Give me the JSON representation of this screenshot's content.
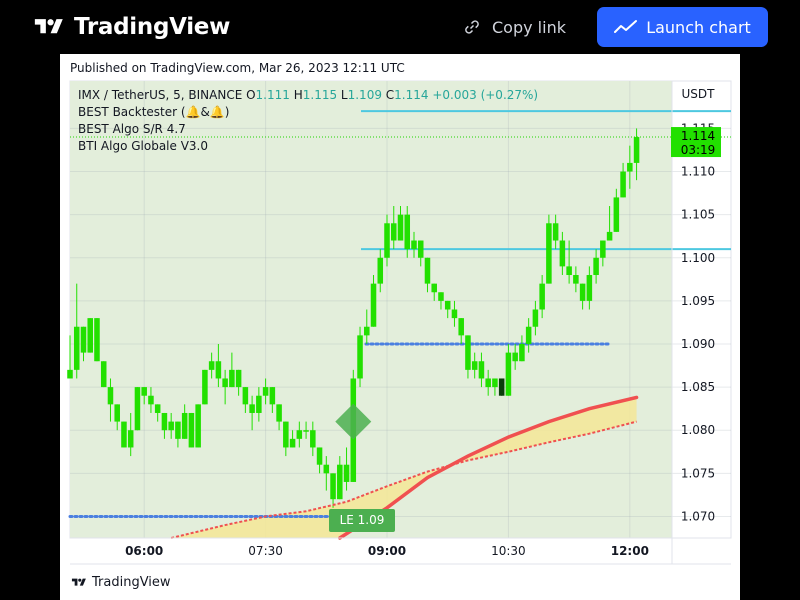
{
  "header": {
    "brand": "TradingView",
    "copy_link_label": "Copy link",
    "launch_chart_label": "Launch chart"
  },
  "published": "Published on TradingView.com, Mar 26, 2023 12:11 UTC",
  "footer_brand": "TradingView",
  "chart_data": {
    "type": "candlestick",
    "symbol_line": {
      "symbol": "IMX / TetherUS, 5, BINANCE",
      "o_label": "O",
      "o_value": "1.111",
      "h_label": "H",
      "h_value": "1.115",
      "l_label": "L",
      "l_value": "1.109",
      "c_label": "C",
      "c_value": "1.114",
      "change": "+0.003 (+0.27%)"
    },
    "indicators": [
      "BEST Backtester (🔔&🔔)",
      "BEST Algo S/R 4.7",
      "BTI Algo Globale V3.0"
    ],
    "y_axis_unit": "USDT",
    "y_ticks": [
      "1.115",
      "1.110",
      "1.105",
      "1.100",
      "1.095",
      "1.090",
      "1.085",
      "1.080",
      "1.075",
      "1.070"
    ],
    "ylim": [
      1.0675,
      1.1205
    ],
    "x_ticks": [
      "06:00",
      "07:30",
      "09:00",
      "10:30",
      "12:00"
    ],
    "x_tick_times": [
      "06:00",
      "07:30",
      "09:00",
      "10:30",
      "12:00"
    ],
    "xlim": [
      "05:05",
      "13:15"
    ],
    "last_price": "1.114",
    "countdown": "03:19",
    "trade_label": "LE 1.09",
    "resistance_levels": [
      1.117,
      1.101
    ],
    "dotted_levels": [
      1.09,
      1.07
    ],
    "candles": [
      {
        "t": "05:05",
        "o": 1.086,
        "h": 1.091,
        "l": 1.086,
        "c": 1.087
      },
      {
        "t": "05:10",
        "o": 1.087,
        "h": 1.097,
        "l": 1.086,
        "c": 1.092
      },
      {
        "t": "05:15",
        "o": 1.092,
        "h": 1.092,
        "l": 1.088,
        "c": 1.089
      },
      {
        "t": "05:20",
        "o": 1.089,
        "h": 1.093,
        "l": 1.089,
        "c": 1.093
      },
      {
        "t": "05:25",
        "o": 1.093,
        "h": 1.093,
        "l": 1.088,
        "c": 1.088
      },
      {
        "t": "05:30",
        "o": 1.088,
        "h": 1.088,
        "l": 1.085,
        "c": 1.085
      },
      {
        "t": "05:35",
        "o": 1.085,
        "h": 1.086,
        "l": 1.081,
        "c": 1.083
      },
      {
        "t": "05:40",
        "o": 1.083,
        "h": 1.083,
        "l": 1.08,
        "c": 1.081
      },
      {
        "t": "05:45",
        "o": 1.081,
        "h": 1.081,
        "l": 1.078,
        "c": 1.078
      },
      {
        "t": "05:50",
        "o": 1.078,
        "h": 1.082,
        "l": 1.077,
        "c": 1.08
      },
      {
        "t": "05:55",
        "o": 1.08,
        "h": 1.085,
        "l": 1.08,
        "c": 1.085
      },
      {
        "t": "06:00",
        "o": 1.085,
        "h": 1.085,
        "l": 1.083,
        "c": 1.084
      },
      {
        "t": "06:05",
        "o": 1.084,
        "h": 1.085,
        "l": 1.082,
        "c": 1.083
      },
      {
        "t": "06:10",
        "o": 1.083,
        "h": 1.083,
        "l": 1.081,
        "c": 1.082
      },
      {
        "t": "06:15",
        "o": 1.082,
        "h": 1.082,
        "l": 1.079,
        "c": 1.08
      },
      {
        "t": "06:20",
        "o": 1.08,
        "h": 1.082,
        "l": 1.079,
        "c": 1.081
      },
      {
        "t": "06:25",
        "o": 1.081,
        "h": 1.081,
        "l": 1.078,
        "c": 1.079
      },
      {
        "t": "06:30",
        "o": 1.079,
        "h": 1.083,
        "l": 1.079,
        "c": 1.082
      },
      {
        "t": "06:35",
        "o": 1.082,
        "h": 1.082,
        "l": 1.078,
        "c": 1.078
      },
      {
        "t": "06:40",
        "o": 1.078,
        "h": 1.083,
        "l": 1.078,
        "c": 1.083
      },
      {
        "t": "06:45",
        "o": 1.083,
        "h": 1.087,
        "l": 1.083,
        "c": 1.087
      },
      {
        "t": "06:50",
        "o": 1.087,
        "h": 1.089,
        "l": 1.086,
        "c": 1.088
      },
      {
        "t": "06:55",
        "o": 1.088,
        "h": 1.09,
        "l": 1.085,
        "c": 1.086
      },
      {
        "t": "07:00",
        "o": 1.086,
        "h": 1.087,
        "l": 1.083,
        "c": 1.085
      },
      {
        "t": "07:05",
        "o": 1.085,
        "h": 1.089,
        "l": 1.085,
        "c": 1.087
      },
      {
        "t": "07:10",
        "o": 1.087,
        "h": 1.087,
        "l": 1.084,
        "c": 1.085
      },
      {
        "t": "07:15",
        "o": 1.085,
        "h": 1.085,
        "l": 1.082,
        "c": 1.083
      },
      {
        "t": "07:20",
        "o": 1.083,
        "h": 1.084,
        "l": 1.08,
        "c": 1.082
      },
      {
        "t": "07:25",
        "o": 1.082,
        "h": 1.085,
        "l": 1.081,
        "c": 1.084
      },
      {
        "t": "07:30",
        "o": 1.084,
        "h": 1.086,
        "l": 1.083,
        "c": 1.085
      },
      {
        "t": "07:35",
        "o": 1.085,
        "h": 1.085,
        "l": 1.082,
        "c": 1.083
      },
      {
        "t": "07:40",
        "o": 1.083,
        "h": 1.083,
        "l": 1.08,
        "c": 1.081
      },
      {
        "t": "07:45",
        "o": 1.081,
        "h": 1.081,
        "l": 1.077,
        "c": 1.078
      },
      {
        "t": "07:50",
        "o": 1.078,
        "h": 1.08,
        "l": 1.078,
        "c": 1.079
      },
      {
        "t": "07:55",
        "o": 1.079,
        "h": 1.081,
        "l": 1.078,
        "c": 1.08
      },
      {
        "t": "08:00",
        "o": 1.08,
        "h": 1.081,
        "l": 1.079,
        "c": 1.08
      },
      {
        "t": "08:05",
        "o": 1.08,
        "h": 1.081,
        "l": 1.077,
        "c": 1.078
      },
      {
        "t": "08:10",
        "o": 1.078,
        "h": 1.078,
        "l": 1.075,
        "c": 1.076
      },
      {
        "t": "08:15",
        "o": 1.076,
        "h": 1.077,
        "l": 1.073,
        "c": 1.075
      },
      {
        "t": "08:20",
        "o": 1.075,
        "h": 1.075,
        "l": 1.071,
        "c": 1.072
      },
      {
        "t": "08:25",
        "o": 1.072,
        "h": 1.077,
        "l": 1.072,
        "c": 1.076
      },
      {
        "t": "08:30",
        "o": 1.076,
        "h": 1.078,
        "l": 1.073,
        "c": 1.074
      },
      {
        "t": "08:35",
        "o": 1.074,
        "h": 1.087,
        "l": 1.074,
        "c": 1.086
      },
      {
        "t": "08:40",
        "o": 1.086,
        "h": 1.092,
        "l": 1.085,
        "c": 1.091
      },
      {
        "t": "08:45",
        "o": 1.091,
        "h": 1.094,
        "l": 1.09,
        "c": 1.092
      },
      {
        "t": "08:50",
        "o": 1.092,
        "h": 1.098,
        "l": 1.092,
        "c": 1.097
      },
      {
        "t": "08:55",
        "o": 1.097,
        "h": 1.101,
        "l": 1.096,
        "c": 1.1
      },
      {
        "t": "09:00",
        "o": 1.1,
        "h": 1.105,
        "l": 1.099,
        "c": 1.104
      },
      {
        "t": "09:05",
        "o": 1.104,
        "h": 1.106,
        "l": 1.101,
        "c": 1.102
      },
      {
        "t": "09:10",
        "o": 1.102,
        "h": 1.106,
        "l": 1.102,
        "c": 1.105
      },
      {
        "t": "09:15",
        "o": 1.105,
        "h": 1.106,
        "l": 1.1,
        "c": 1.101
      },
      {
        "t": "09:20",
        "o": 1.101,
        "h": 1.103,
        "l": 1.1,
        "c": 1.102
      },
      {
        "t": "09:25",
        "o": 1.102,
        "h": 1.102,
        "l": 1.099,
        "c": 1.1
      },
      {
        "t": "09:30",
        "o": 1.1,
        "h": 1.1,
        "l": 1.096,
        "c": 1.097
      },
      {
        "t": "09:35",
        "o": 1.097,
        "h": 1.097,
        "l": 1.095,
        "c": 1.096
      },
      {
        "t": "09:40",
        "o": 1.096,
        "h": 1.096,
        "l": 1.094,
        "c": 1.095
      },
      {
        "t": "09:45",
        "o": 1.095,
        "h": 1.095,
        "l": 1.093,
        "c": 1.094
      },
      {
        "t": "09:50",
        "o": 1.094,
        "h": 1.095,
        "l": 1.092,
        "c": 1.093
      },
      {
        "t": "09:55",
        "o": 1.093,
        "h": 1.093,
        "l": 1.09,
        "c": 1.091
      },
      {
        "t": "10:00",
        "o": 1.091,
        "h": 1.091,
        "l": 1.086,
        "c": 1.087
      },
      {
        "t": "10:05",
        "o": 1.087,
        "h": 1.089,
        "l": 1.086,
        "c": 1.088
      },
      {
        "t": "10:10",
        "o": 1.088,
        "h": 1.089,
        "l": 1.085,
        "c": 1.086
      },
      {
        "t": "10:15",
        "o": 1.086,
        "h": 1.087,
        "l": 1.084,
        "c": 1.085
      },
      {
        "t": "10:20",
        "o": 1.085,
        "h": 1.086,
        "l": 1.084,
        "c": 1.086
      },
      {
        "t": "10:25",
        "o": 1.086,
        "h": 1.086,
        "l": 1.084,
        "c": 1.084
      },
      {
        "t": "10:30",
        "o": 1.084,
        "h": 1.09,
        "l": 1.084,
        "c": 1.089
      },
      {
        "t": "10:35",
        "o": 1.089,
        "h": 1.09,
        "l": 1.087,
        "c": 1.088
      },
      {
        "t": "10:40",
        "o": 1.088,
        "h": 1.091,
        "l": 1.088,
        "c": 1.09
      },
      {
        "t": "10:45",
        "o": 1.09,
        "h": 1.093,
        "l": 1.089,
        "c": 1.092
      },
      {
        "t": "10:50",
        "o": 1.092,
        "h": 1.095,
        "l": 1.091,
        "c": 1.094
      },
      {
        "t": "10:55",
        "o": 1.094,
        "h": 1.098,
        "l": 1.093,
        "c": 1.097
      },
      {
        "t": "11:00",
        "o": 1.097,
        "h": 1.105,
        "l": 1.097,
        "c": 1.104
      },
      {
        "t": "11:05",
        "o": 1.104,
        "h": 1.105,
        "l": 1.101,
        "c": 1.102
      },
      {
        "t": "11:10",
        "o": 1.102,
        "h": 1.103,
        "l": 1.098,
        "c": 1.099
      },
      {
        "t": "11:15",
        "o": 1.099,
        "h": 1.102,
        "l": 1.097,
        "c": 1.098
      },
      {
        "t": "11:20",
        "o": 1.098,
        "h": 1.099,
        "l": 1.096,
        "c": 1.097
      },
      {
        "t": "11:25",
        "o": 1.097,
        "h": 1.097,
        "l": 1.094,
        "c": 1.095
      },
      {
        "t": "11:30",
        "o": 1.095,
        "h": 1.099,
        "l": 1.094,
        "c": 1.098
      },
      {
        "t": "11:35",
        "o": 1.098,
        "h": 1.101,
        "l": 1.097,
        "c": 1.1
      },
      {
        "t": "11:40",
        "o": 1.1,
        "h": 1.102,
        "l": 1.099,
        "c": 1.102
      },
      {
        "t": "11:45",
        "o": 1.102,
        "h": 1.106,
        "l": 1.102,
        "c": 1.103
      },
      {
        "t": "11:50",
        "o": 1.103,
        "h": 1.108,
        "l": 1.103,
        "c": 1.107
      },
      {
        "t": "11:55",
        "o": 1.107,
        "h": 1.111,
        "l": 1.107,
        "c": 1.11
      },
      {
        "t": "12:00",
        "o": 1.11,
        "h": 1.113,
        "l": 1.108,
        "c": 1.111
      },
      {
        "t": "12:05",
        "o": 1.111,
        "h": 1.115,
        "l": 1.109,
        "c": 1.114
      }
    ],
    "ema_fast": [
      {
        "t": "08:25",
        "v": 1.0675
      },
      {
        "t": "08:40",
        "v": 1.069
      },
      {
        "t": "09:00",
        "v": 1.071
      },
      {
        "t": "09:30",
        "v": 1.0745
      },
      {
        "t": "10:00",
        "v": 1.077
      },
      {
        "t": "10:30",
        "v": 1.0792
      },
      {
        "t": "11:00",
        "v": 1.081
      },
      {
        "t": "11:30",
        "v": 1.0825
      },
      {
        "t": "12:05",
        "v": 1.0838
      }
    ],
    "ema_slow": [
      {
        "t": "06:20",
        "v": 1.0675
      },
      {
        "t": "07:00",
        "v": 1.069
      },
      {
        "t": "07:30",
        "v": 1.07
      },
      {
        "t": "08:00",
        "v": 1.0706
      },
      {
        "t": "08:30",
        "v": 1.0717
      },
      {
        "t": "09:00",
        "v": 1.0735
      },
      {
        "t": "09:30",
        "v": 1.0752
      },
      {
        "t": "10:00",
        "v": 1.0765
      },
      {
        "t": "10:30",
        "v": 1.0775
      },
      {
        "t": "11:00",
        "v": 1.0786
      },
      {
        "t": "11:30",
        "v": 1.0796
      },
      {
        "t": "12:05",
        "v": 1.081
      }
    ],
    "signal_marker": {
      "t": "08:35",
      "v": 1.081
    }
  }
}
